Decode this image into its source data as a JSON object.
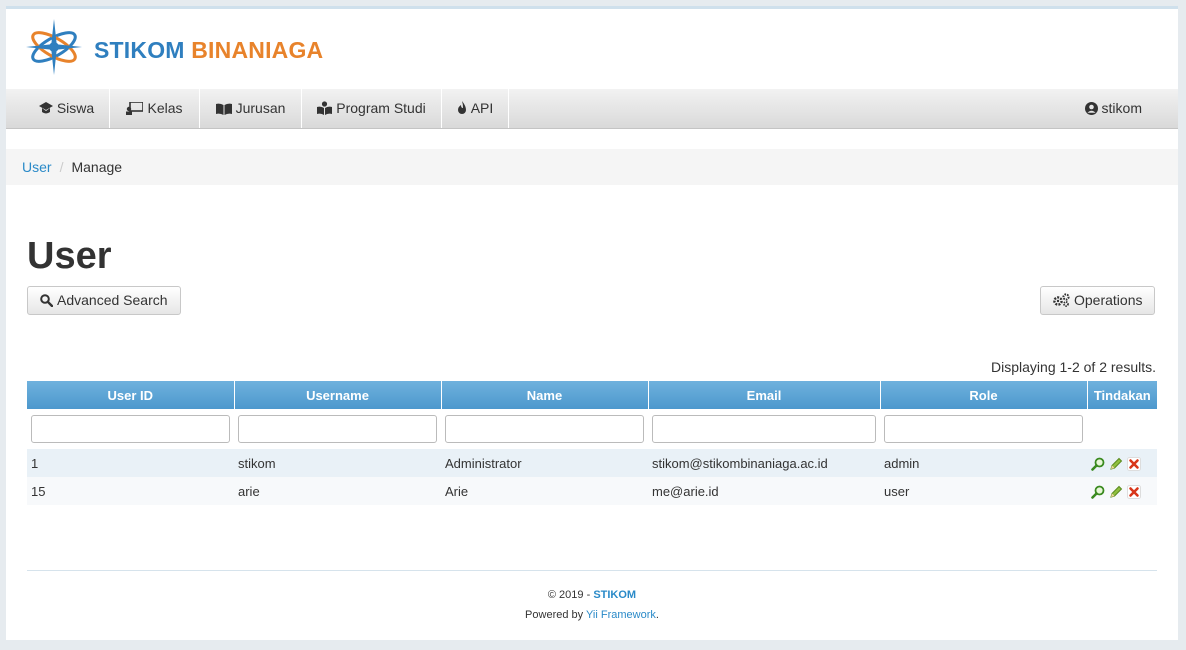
{
  "brand": {
    "part1": "STIKOM",
    "part2": "BINANIAGA",
    "color1": "#2f7fbf",
    "color2": "#e8832b"
  },
  "nav": {
    "items": [
      {
        "label": "Siswa",
        "icon": "graduation-cap-icon"
      },
      {
        "label": "Kelas",
        "icon": "classroom-icon"
      },
      {
        "label": "Jurusan",
        "icon": "book-icon"
      },
      {
        "label": "Program Studi",
        "icon": "reader-icon"
      },
      {
        "label": "API",
        "icon": "fire-icon"
      }
    ],
    "user": {
      "label": "stikom",
      "icon": "user-circle-icon"
    }
  },
  "breadcrumb": {
    "parent": "User",
    "current": "Manage"
  },
  "page": {
    "title": "User"
  },
  "buttons": {
    "advanced_search": "Advanced Search",
    "operations": "Operations"
  },
  "grid": {
    "summary": "Displaying 1-2 of 2 results.",
    "columns": [
      "User ID",
      "Username",
      "Name",
      "Email",
      "Role",
      "Tindakan"
    ],
    "rows": [
      {
        "id": "1",
        "username": "stikom",
        "name": "Administrator",
        "email": "stikom@stikombinaniaga.ac.id",
        "role": "admin"
      },
      {
        "id": "15",
        "username": "arie",
        "name": "Arie",
        "email": "me@arie.id",
        "role": "user"
      }
    ],
    "action_icons": [
      "view-icon",
      "edit-icon",
      "delete-icon"
    ]
  },
  "footer": {
    "copyright_prefix": "© 2019 - ",
    "copyright_brand": "STIKOM",
    "powered_prefix": "Powered by ",
    "framework": "Yii Framework",
    "powered_suffix": "."
  },
  "colors": {
    "header_blue": "#4c98cd",
    "link": "#2a8ac8"
  }
}
